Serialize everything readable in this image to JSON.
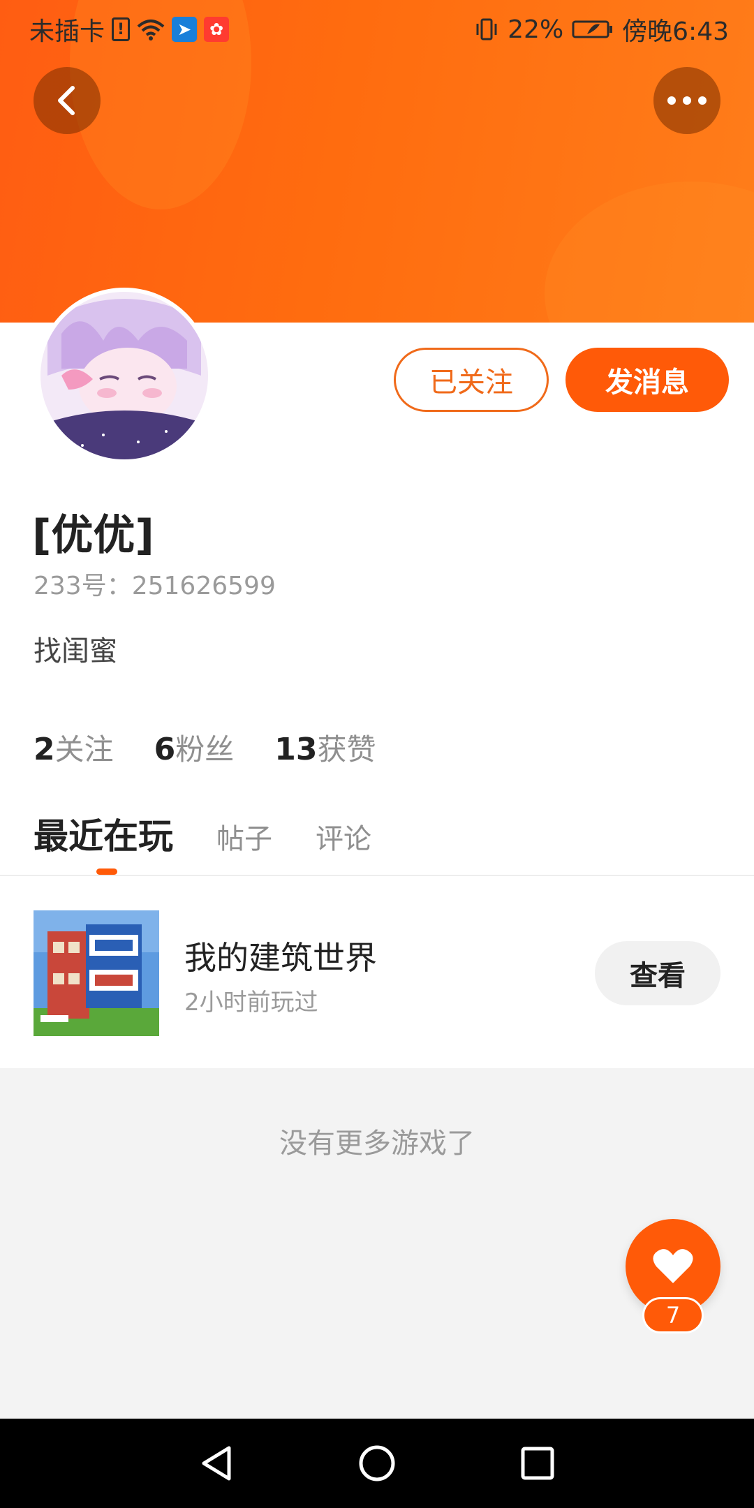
{
  "status_bar": {
    "carrier": "未插卡",
    "battery": "22%",
    "time": "傍晚6:43"
  },
  "profile": {
    "follow_state_label": "已关注",
    "message_label": "发消息",
    "username": "[优优]",
    "uid_label": "233号：",
    "uid_value": "251626599",
    "bio": "找闺蜜"
  },
  "stats": [
    {
      "value": "2",
      "label": "关注"
    },
    {
      "value": "6",
      "label": "粉丝"
    },
    {
      "value": "13",
      "label": "获赞"
    }
  ],
  "tabs": [
    {
      "label": "最近在玩",
      "active": true
    },
    {
      "label": "帖子",
      "active": false
    },
    {
      "label": "评论",
      "active": false
    }
  ],
  "games": [
    {
      "title": "我的建筑世界",
      "last_played": "2小时前玩过",
      "action_label": "查看"
    }
  ],
  "footer_text": "没有更多游戏了",
  "like_fab": {
    "count": "7"
  },
  "colors": {
    "accent": "#ff5a08",
    "banner": "#ff6c0f"
  }
}
